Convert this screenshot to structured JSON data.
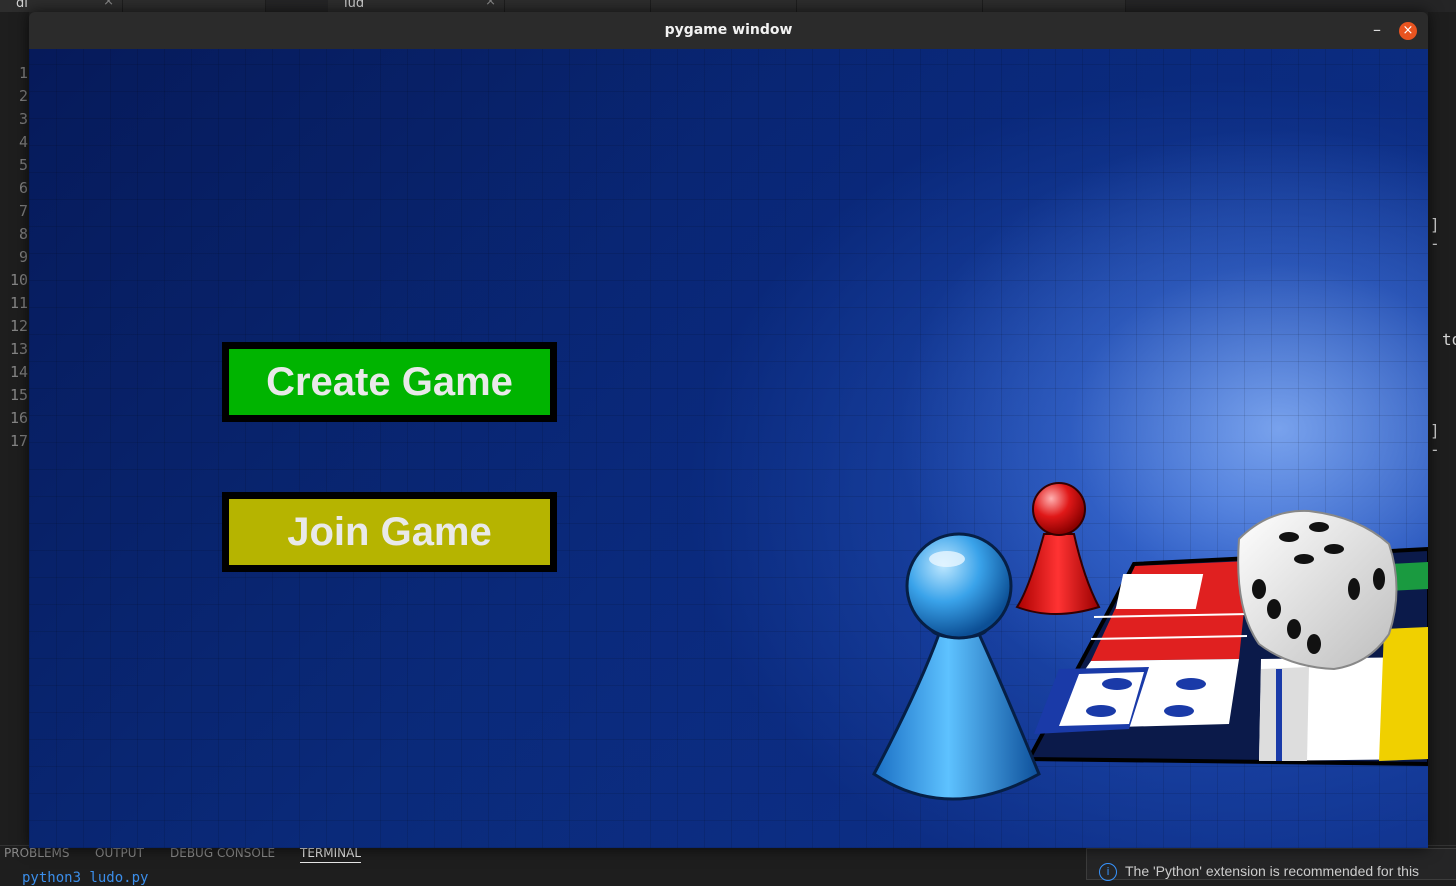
{
  "editor": {
    "tabs": [
      "di",
      "",
      "lud",
      "",
      "",
      "",
      "",
      ""
    ],
    "line_numbers": [
      "1",
      "2",
      "3",
      "4",
      "5",
      "6",
      "7",
      "8",
      "9",
      "10",
      "11",
      "12",
      "13",
      "14",
      "15",
      "16",
      "17"
    ],
    "right_fragments": [
      "] -",
      "to",
      "] -"
    ]
  },
  "panel": {
    "tabs": [
      "PROBLEMS",
      "OUTPUT",
      "DEBUG CONSOLE",
      "TERMINAL"
    ],
    "active_tab": "TERMINAL",
    "terminal_line": "python3 ludo.py"
  },
  "notification": {
    "text": "The 'Python' extension is recommended for this"
  },
  "window": {
    "title": "pygame window",
    "minimize_symbol": "–",
    "close_symbol": "×"
  },
  "game": {
    "create_label": "Create Game",
    "join_label": "Join Game",
    "colors": {
      "create_bg": "#00b400",
      "join_bg": "#b6b400",
      "button_text": "#e9e9e9",
      "background": "#0a2a7a"
    },
    "artwork": "ludo-board-with-pawns-and-dice"
  }
}
